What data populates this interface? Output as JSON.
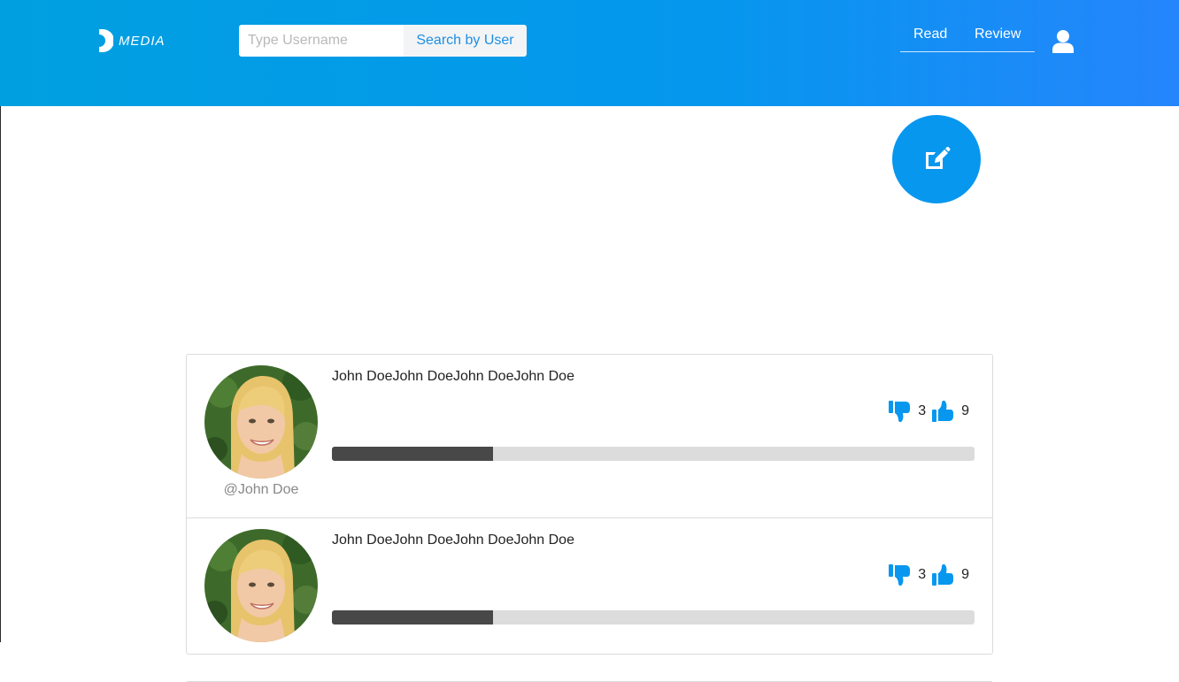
{
  "header": {
    "logo_text": "MEDIA",
    "search": {
      "placeholder": "Type Username",
      "value": "",
      "button_label": "Search by User"
    },
    "nav": [
      {
        "label": "Read"
      },
      {
        "label": "Review"
      }
    ],
    "user_icon": "user-icon"
  },
  "fab": {
    "icon": "edit-icon"
  },
  "colors": {
    "header_start": "#00a0e0",
    "header_end": "#2585fc",
    "accent": "#0797ef",
    "progress_fill": "#484848",
    "progress_track": "#dcdcdc"
  },
  "posts": [
    {
      "title": "John DoeJohn DoeJohn DoeJohn Doe",
      "username": "@John Doe",
      "dislikes": "3",
      "likes": "9",
      "progress": 0.25
    },
    {
      "title": "John DoeJohn DoeJohn DoeJohn Doe",
      "username": "",
      "dislikes": "3",
      "likes": "9",
      "progress": 0.25
    }
  ]
}
